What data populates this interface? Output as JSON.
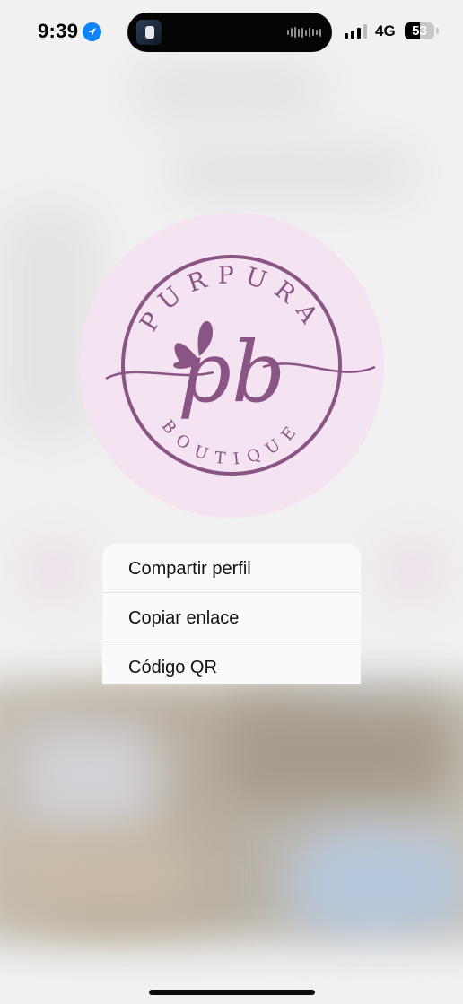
{
  "status_bar": {
    "time": "9:39",
    "network": "4G",
    "battery": "53",
    "battery_level": 0.53,
    "location_icon": "location-arrow-icon"
  },
  "logo": {
    "top_text": "PURPURA",
    "monogram": "pb",
    "bottom_text": "BOUTIQUE",
    "brand_color": "#8a5484",
    "background_color": "#f4e3f0"
  },
  "menu": {
    "items": [
      {
        "label": "Compartir perfil"
      },
      {
        "label": "Copiar enlace"
      },
      {
        "label": "Código QR"
      }
    ]
  }
}
